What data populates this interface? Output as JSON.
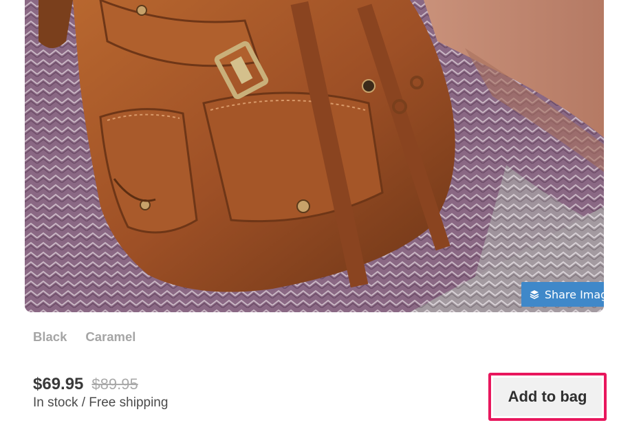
{
  "product_image": {
    "share_label": "Share Image",
    "share_icon": "layers-icon"
  },
  "variants": [
    {
      "label": "Black"
    },
    {
      "label": "Caramel"
    }
  ],
  "pricing": {
    "current_price": "$69.95",
    "original_price": "$89.95",
    "stock_status": "In stock / Free shipping"
  },
  "actions": {
    "add_to_bag_label": "Add to bag",
    "highlight_color": "#e8175d"
  },
  "colors": {
    "share_button": "#3f88c9",
    "backpack": "#a4562a",
    "fabric": "#8c6a86"
  }
}
